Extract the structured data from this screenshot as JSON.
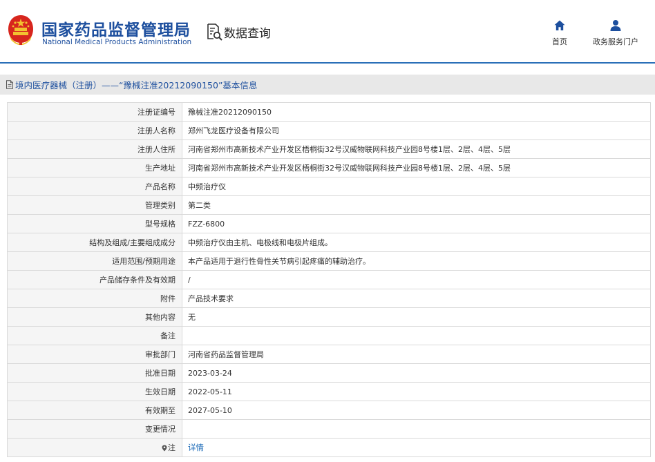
{
  "header": {
    "brand_cn": "国家药品监督管理局",
    "brand_en": "National Medical Products Administration",
    "query_label": "数据查询",
    "nav": {
      "home_label": "首页",
      "gov_service_label": "政务服务门户"
    }
  },
  "breadcrumb": {
    "text": "境内医疗器械（注册）——“豫械注准20212090150”基本信息"
  },
  "rows": [
    {
      "label": "注册证编号",
      "value": "豫械注准20212090150"
    },
    {
      "label": "注册人名称",
      "value": "郑州飞龙医疗设备有限公司"
    },
    {
      "label": "注册人住所",
      "value": "河南省郑州市高新技术产业开发区梧桐街32号汉威物联网科技产业园8号楼1层、2层、4层、5层"
    },
    {
      "label": "生产地址",
      "value": "河南省郑州市高新技术产业开发区梧桐街32号汉威物联网科技产业园8号楼1层、2层、4层、5层"
    },
    {
      "label": "产品名称",
      "value": "中频治疗仪"
    },
    {
      "label": "管理类别",
      "value": "第二类"
    },
    {
      "label": "型号规格",
      "value": "FZZ-6800"
    },
    {
      "label": "结构及组成/主要组成成分",
      "value": "中频治疗仪由主机、电极线和电极片组成。"
    },
    {
      "label": "适用范围/预期用途",
      "value": "本产品适用于退行性骨性关节病引起疼痛的辅助治疗。"
    },
    {
      "label": "产品储存条件及有效期",
      "value": "/"
    },
    {
      "label": "附件",
      "value": "产品技术要求"
    },
    {
      "label": "其他内容",
      "value": "无"
    },
    {
      "label": "备注",
      "value": ""
    },
    {
      "label": "审批部门",
      "value": "河南省药品监督管理局"
    },
    {
      "label": "批准日期",
      "value": "2023-03-24"
    },
    {
      "label": "生效日期",
      "value": "2022-05-11"
    },
    {
      "label": "有效期至",
      "value": "2027-05-10"
    },
    {
      "label": "变更情况",
      "value": ""
    }
  ],
  "note_row": {
    "label": "注",
    "link": "详情"
  },
  "colors": {
    "brand_blue": "#1d4f9e",
    "link_blue": "#1d6bb8",
    "divider_blue": "#2a6fb8",
    "label_bg": "#f5f5f5",
    "crumb_bg": "#e8e8e8"
  }
}
